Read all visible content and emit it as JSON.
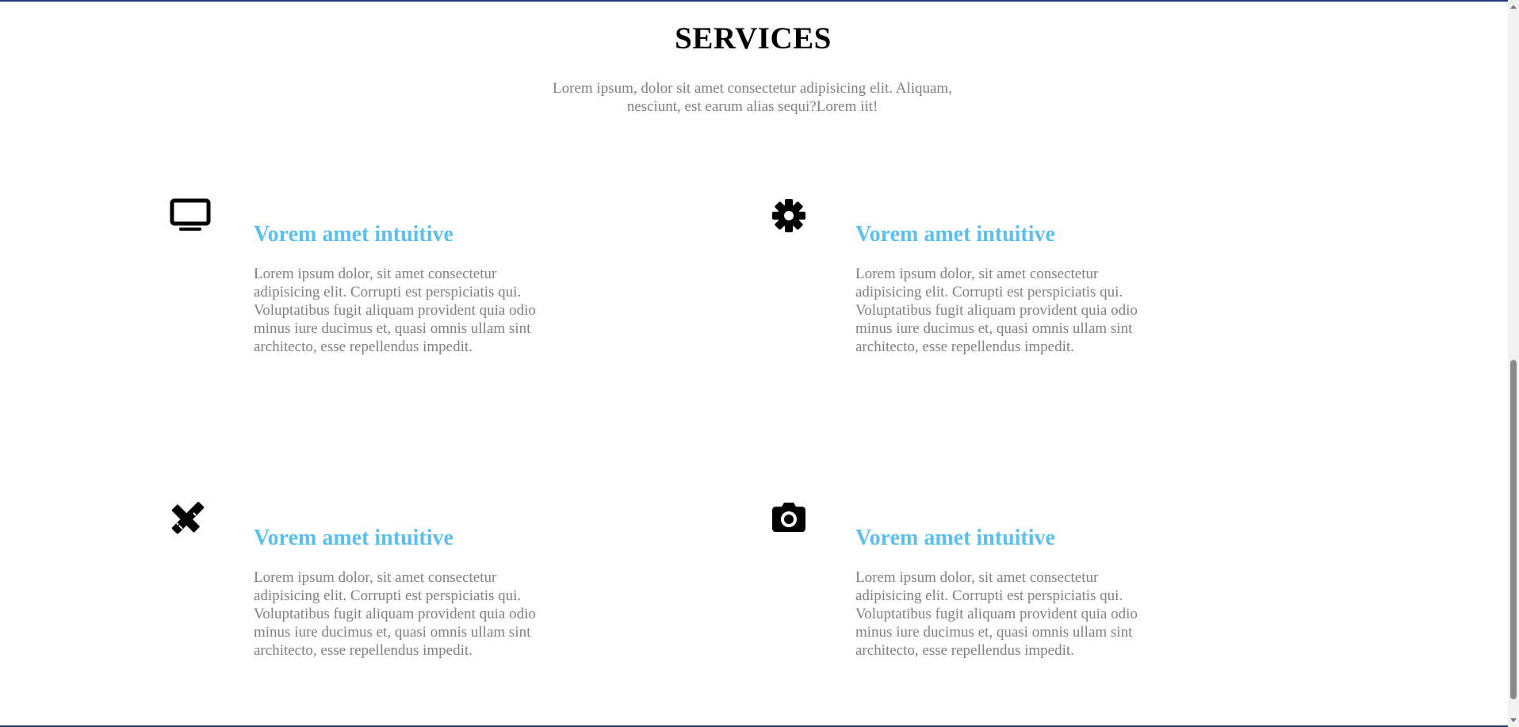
{
  "section": {
    "title": "SERVICES",
    "subtitle": "Lorem ipsum, dolor sit amet consectetur adipisicing elit. Aliquam, nesciunt, est earum alias sequi?Lorem iit!"
  },
  "services": [
    {
      "icon": "monitor-icon",
      "title": "Vorem amet intuitive",
      "text": "Lorem ipsum dolor, sit amet consectetur adipisicing elit. Corrupti est perspiciatis qui. Voluptatibus fugit aliquam provident quia odio minus iure ducimus et, quasi omnis ullam sint architecto, esse repellendus impedit."
    },
    {
      "icon": "gear-icon",
      "title": "Vorem amet intuitive",
      "text": "Lorem ipsum dolor, sit amet consectetur adipisicing elit. Corrupti est perspiciatis qui. Voluptatibus fugit aliquam provident quia odio minus iure ducimus et, quasi omnis ullam sint architecto, esse repellendus impedit."
    },
    {
      "icon": "pencil-ruler-icon",
      "title": "Vorem amet intuitive",
      "text": "Lorem ipsum dolor, sit amet consectetur adipisicing elit. Corrupti est perspiciatis qui. Voluptatibus fugit aliquam provident quia odio minus iure ducimus et, quasi omnis ullam sint architecto, esse repellendus impedit."
    },
    {
      "icon": "camera-icon",
      "title": "Vorem amet intuitive",
      "text": "Lorem ipsum dolor, sit amet consectetur adipisicing elit. Corrupti est perspiciatis qui. Voluptatibus fugit aliquam provident quia odio minus iure ducimus et, quasi omnis ullam sint architecto, esse repellendus impedit."
    }
  ],
  "colors": {
    "heading": "#000000",
    "service_title": "#5bc0eb",
    "body_text": "#808080",
    "accent_rule": "#1f3d7a"
  }
}
